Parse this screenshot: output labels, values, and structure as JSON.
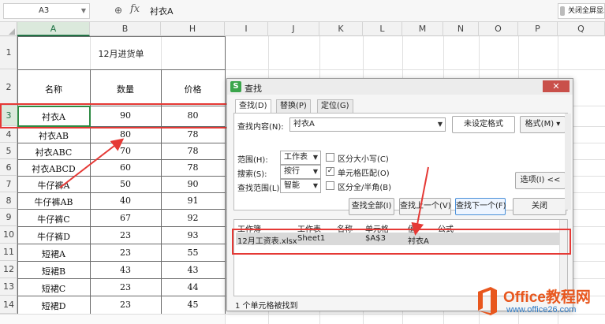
{
  "formula_bar": {
    "name_box": "A3",
    "fx_label": "fx",
    "value": "衬衣A",
    "right_button": "关闭全屏显示"
  },
  "columns": [
    "A",
    "B",
    "H",
    "I",
    "J",
    "K",
    "L",
    "M",
    "N",
    "O",
    "P",
    "Q"
  ],
  "active_column": "A",
  "rows": [
    "1",
    "2",
    "3",
    "4",
    "5",
    "6",
    "7",
    "8",
    "9",
    "10",
    "11",
    "12",
    "13",
    "14"
  ],
  "active_row": "3",
  "sheet": {
    "title": "12月进货单",
    "headers": [
      "名称",
      "数量",
      "价格"
    ],
    "data": [
      [
        "衬衣A",
        "90",
        "80"
      ],
      [
        "衬衣AB",
        "80",
        "78"
      ],
      [
        "衬衣ABC",
        "70",
        "78"
      ],
      [
        "衬衣ABCD",
        "60",
        "78"
      ],
      [
        "牛仔裤A",
        "50",
        "90"
      ],
      [
        "牛仔裤AB",
        "40",
        "91"
      ],
      [
        "牛仔裤C",
        "67",
        "92"
      ],
      [
        "牛仔裤D",
        "23",
        "93"
      ],
      [
        "短裙A",
        "23",
        "55"
      ],
      [
        "短裙B",
        "43",
        "43"
      ],
      [
        "短裙C",
        "23",
        "44"
      ],
      [
        "短裙D",
        "23",
        "45"
      ]
    ]
  },
  "dialog": {
    "title": "查找",
    "close_label": "✕",
    "tabs": [
      "查找(D)",
      "替换(P)",
      "定位(G)"
    ],
    "find_label": "查找内容(N):",
    "find_value": "衬衣A",
    "no_format": "未设定格式",
    "format_btn": "格式(M)",
    "scope_label": "范围(H):",
    "scope_value": "工作表",
    "search_label": "搜索(S):",
    "search_value": "按行",
    "lookin_label": "查找范围(L):",
    "lookin_value": "智能",
    "match_case": "区分大小写(C)",
    "match_cell": "单元格匹配(O)",
    "match_width": "区分全/半角(B)",
    "match_cell_checked": "✓",
    "options_btn": "选项(I) <<",
    "find_all_btn": "查找全部(I)",
    "find_prev_btn": "查找上一个(V)",
    "find_next_btn": "查找下一个(F)",
    "close_btn": "关闭",
    "result_headers": [
      "工作簿",
      "工作表",
      "名称",
      "单元格",
      "值",
      "公式"
    ],
    "result_row": [
      "12月工资表.xlsx",
      "Sheet1",
      "",
      "$A$3",
      "衬衣A",
      ""
    ],
    "status": "1 个单元格被找到"
  },
  "watermark": {
    "line1": "Office教程网",
    "line2": "www.office26.com"
  },
  "colors": {
    "selection": "#2e8a43",
    "annotation": "#e53935",
    "watermark_orange": "#e8571e",
    "watermark_blue": "#2f7ac4"
  }
}
